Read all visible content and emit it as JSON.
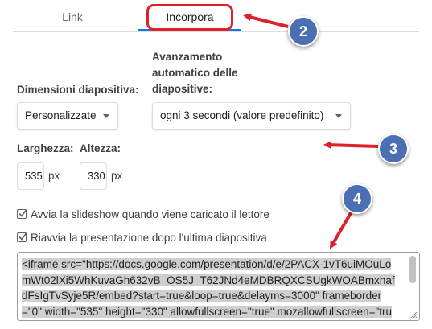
{
  "tabs": {
    "link_label": "Link",
    "embed_label": "Incorpora"
  },
  "slide_size": {
    "label": "Dimensioni diapositiva:",
    "selected": "Personalizzate"
  },
  "auto_advance": {
    "label_lines": [
      "Avanzamento",
      "automatico delle",
      "diapositive:"
    ],
    "selected": "ogni 3 secondi (valore predefinito)"
  },
  "dimensions": {
    "width_label": "Larghezza:",
    "height_label": "Altezza:",
    "width_value": "535",
    "height_value": "330",
    "unit": "px"
  },
  "options": {
    "start_on_load": {
      "label": "Avvia la slideshow quando viene caricato il lettore",
      "checked": true
    },
    "restart_after_last": {
      "label": "Riavvia la presentazione dopo l'ultima diapositiva",
      "checked": true
    }
  },
  "embed_code": "<iframe src=\"https://docs.google.com/presentation/d/e/2PACX-1vT6uiMOuLomWt02lXi5WhKuvaGh632vB_OS5J_T62JNd4eMDBRQXCSUgkWOABmxhafdFsIgTvSyje5R/embed?start=true&loop=true&delayms=3000\" frameborder=\"0\" width=\"535\" height=\"330\" allowfullscreen=\"true\" mozallowfullscreen=\"true\" webkitallowfullscreen=\"true\"></iframe>",
  "callouts": [
    "2",
    "3",
    "4"
  ],
  "colors": {
    "accent": "#1a73e8",
    "highlight_red": "#e0202a",
    "badge_blue": "#4a6fb3"
  }
}
